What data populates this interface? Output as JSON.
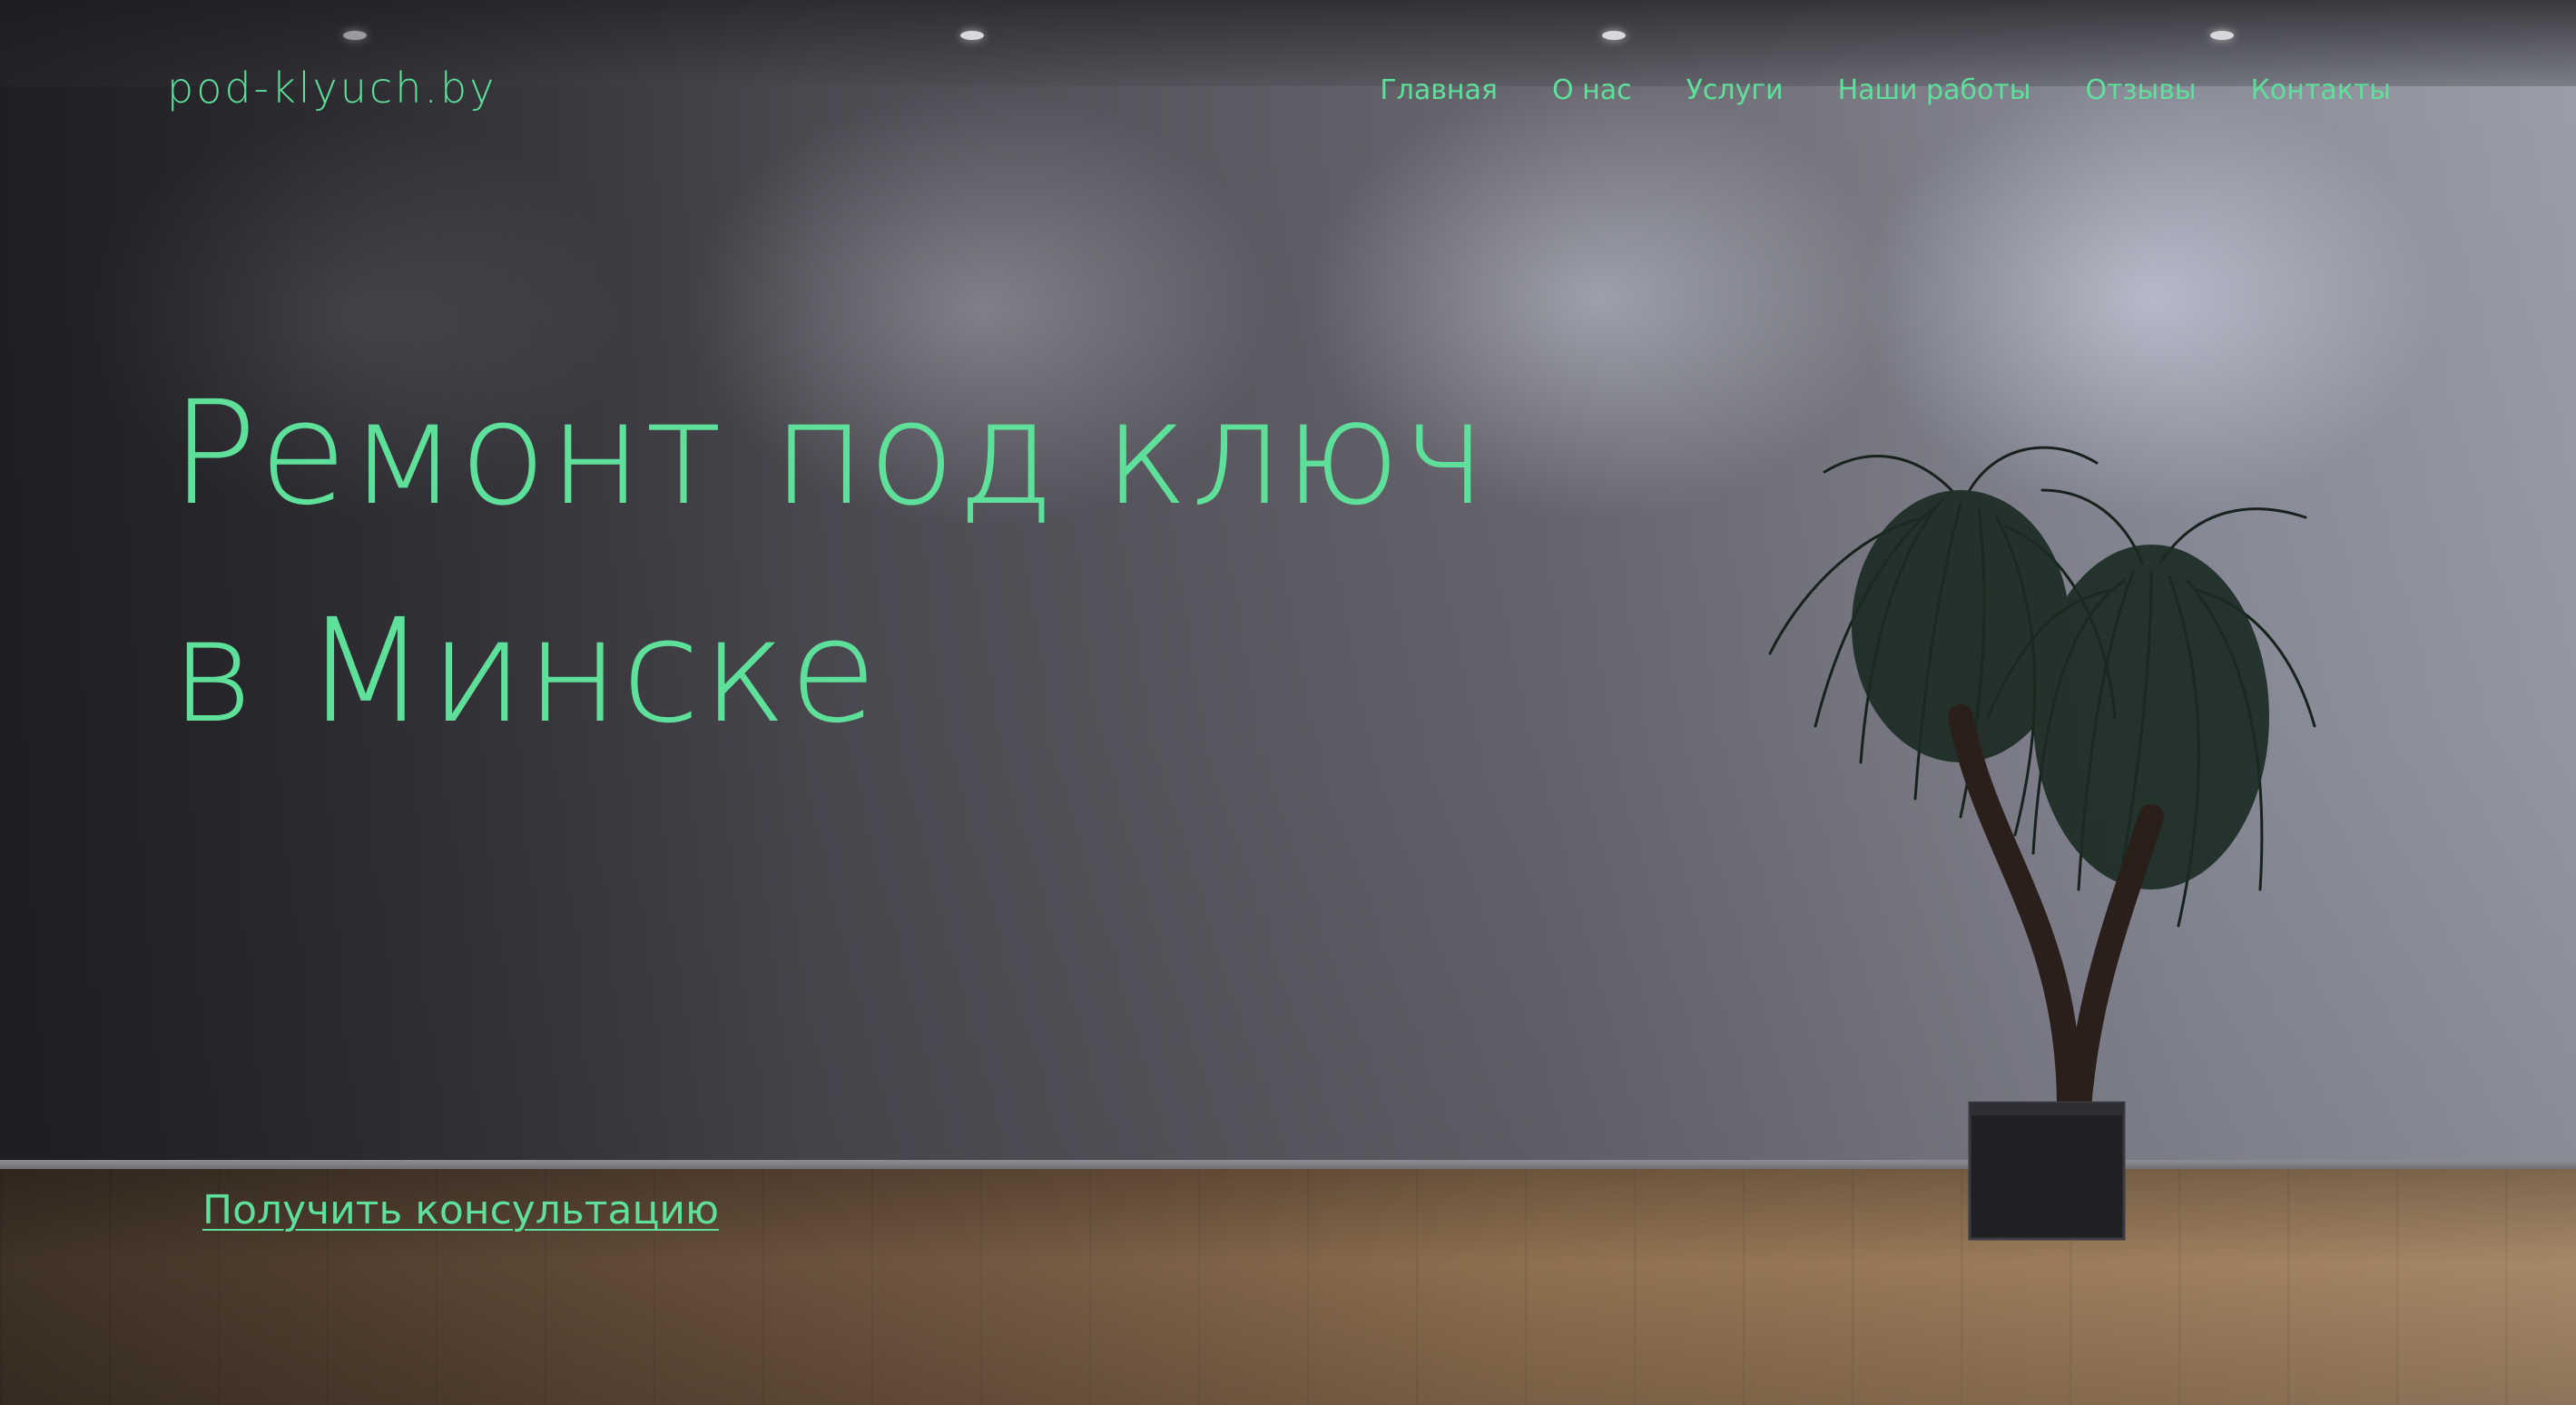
{
  "site": {
    "logo": "pod-klyuch.by",
    "accent_color": "#5ee09a"
  },
  "nav": {
    "items": [
      {
        "label": "Главная"
      },
      {
        "label": "О нас"
      },
      {
        "label": "Услуги"
      },
      {
        "label": "Наши работы"
      },
      {
        "label": "Отзывы"
      },
      {
        "label": "Контакты"
      }
    ]
  },
  "hero": {
    "title_line1": "Ремонт под ключ",
    "title_line2": "в Минске",
    "cta_label": "Получить консультацию"
  }
}
